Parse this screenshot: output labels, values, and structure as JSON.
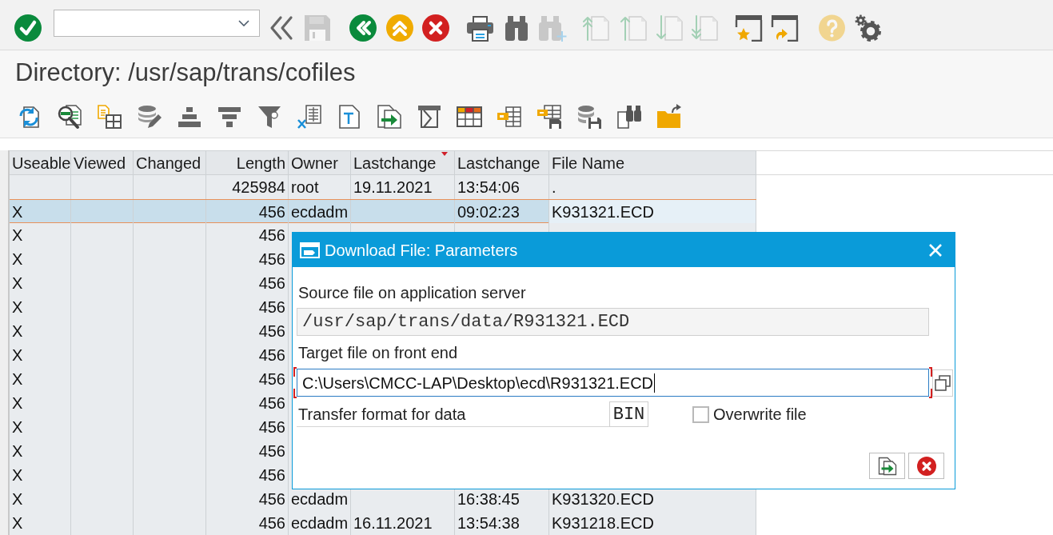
{
  "toolbar": {
    "buttons": [
      {
        "kind": "enter",
        "disabled": false
      },
      {
        "kind": "back_nav",
        "disabled": false
      },
      {
        "kind": "save",
        "disabled": true
      },
      {
        "kind": "back",
        "disabled": false
      },
      {
        "kind": "exit",
        "disabled": false
      },
      {
        "kind": "cancel",
        "disabled": false
      },
      {
        "kind": "print",
        "disabled": false
      },
      {
        "kind": "find",
        "disabled": false
      },
      {
        "kind": "find_next",
        "disabled": true
      },
      {
        "kind": "first_page",
        "disabled": true
      },
      {
        "kind": "previous_page",
        "disabled": true
      },
      {
        "kind": "next_page",
        "disabled": true
      },
      {
        "kind": "last_page",
        "disabled": true
      },
      {
        "kind": "new_session",
        "disabled": false
      },
      {
        "kind": "shortcut",
        "disabled": false
      },
      {
        "kind": "help",
        "disabled": true
      },
      {
        "kind": "customize",
        "disabled": false
      }
    ]
  },
  "title": "Directory: /usr/sap/trans/cofiles",
  "table": {
    "columns": [
      {
        "label": "Useable",
        "sorted": false
      },
      {
        "label": "Viewed",
        "sorted": false
      },
      {
        "label": "Changed",
        "sorted": false
      },
      {
        "label": "Length",
        "sorted": false
      },
      {
        "label": "Owner",
        "sorted": false
      },
      {
        "label": "Lastchange",
        "sorted": true
      },
      {
        "label": "Lastchange",
        "sorted": false
      },
      {
        "label": "File Name",
        "sorted": false
      }
    ],
    "rows": [
      {
        "selected": false,
        "cells": {
          "length": "425984",
          "owner": "root",
          "date": "19.11.2021",
          "time": "13:54:06",
          "file_name": "."
        }
      },
      {
        "selected": true,
        "cells": {
          "useable": "X",
          "length": "456",
          "owner": "ecdadm",
          "time": "09:02:23",
          "file_name": "K931321.ECD"
        }
      },
      {
        "selected": false,
        "cells": {
          "useable": "X",
          "length": "456"
        }
      },
      {
        "selected": false,
        "cells": {
          "useable": "X",
          "length": "456"
        }
      },
      {
        "selected": false,
        "cells": {
          "useable": "X",
          "length": "456"
        }
      },
      {
        "selected": false,
        "cells": {
          "useable": "X",
          "length": "456"
        }
      },
      {
        "selected": false,
        "cells": {
          "useable": "X",
          "length": "456"
        }
      },
      {
        "selected": false,
        "cells": {
          "useable": "X",
          "length": "456"
        }
      },
      {
        "selected": false,
        "cells": {
          "useable": "X",
          "length": "456"
        }
      },
      {
        "selected": false,
        "cells": {
          "useable": "X",
          "length": "456"
        }
      },
      {
        "selected": false,
        "cells": {
          "useable": "X",
          "length": "456"
        }
      },
      {
        "selected": false,
        "cells": {
          "useable": "X",
          "length": "456"
        }
      },
      {
        "selected": false,
        "cells": {
          "useable": "X",
          "length": "456"
        }
      },
      {
        "selected": false,
        "cells": {
          "useable": "X",
          "length": "456",
          "owner": "ecdadm",
          "time": "16:38:45",
          "file_name": "K931320.ECD"
        }
      },
      {
        "selected": false,
        "cells": {
          "useable": "X",
          "length": "456",
          "owner": "ecdadm",
          "date": "16.11.2021",
          "time": "13:54:38",
          "file_name": "K931218.ECD"
        }
      }
    ]
  },
  "dialog": {
    "title": "Download File: Parameters",
    "source": {
      "label": "Source file on application server",
      "value": "/usr/sap/trans/data/R931321.ECD",
      "editable": false
    },
    "target": {
      "label": "Target file on front end",
      "value": "C:\\Users\\CMCC-LAP\\Desktop\\ecd\\R931321.ECD",
      "editable": true,
      "focused": true
    },
    "format": {
      "label": "Transfer format for data",
      "value": "BIN"
    },
    "overwrite": {
      "label": "Overwrite file",
      "checked": false
    }
  }
}
